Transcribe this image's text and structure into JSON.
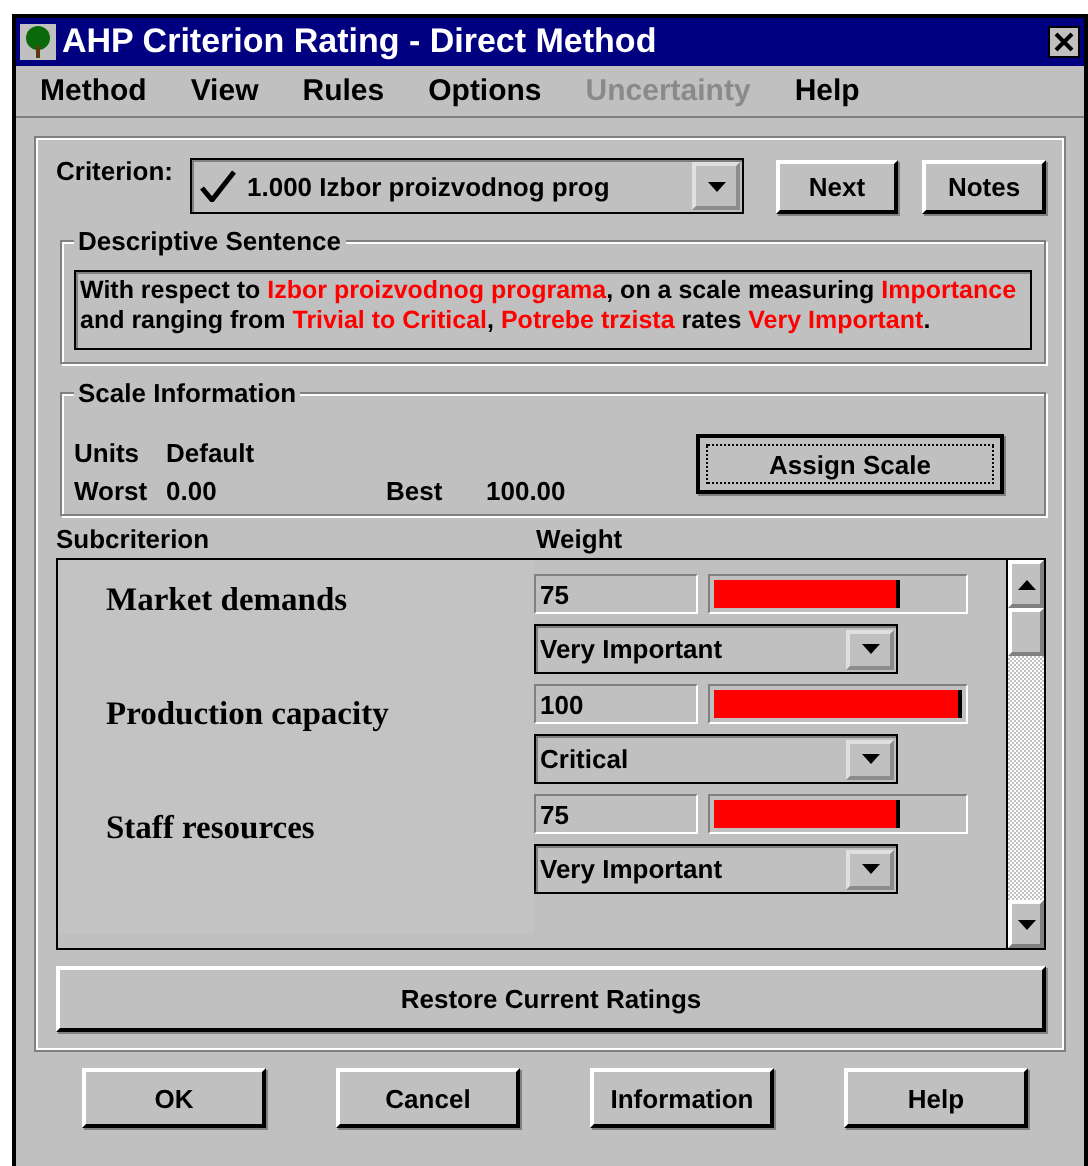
{
  "window": {
    "title": "AHP Criterion Rating - Direct Method"
  },
  "menu": [
    {
      "label": "Method",
      "disabled": false
    },
    {
      "label": "View",
      "disabled": false
    },
    {
      "label": "Rules",
      "disabled": false
    },
    {
      "label": "Options",
      "disabled": false
    },
    {
      "label": "Uncertainty",
      "disabled": true
    },
    {
      "label": "Help",
      "disabled": false
    }
  ],
  "criterion": {
    "label": "Criterion:",
    "checked": true,
    "value": "1.000  Izbor proizvodnog prog",
    "buttons": [
      "Next",
      "Notes"
    ]
  },
  "descriptive_sentence": {
    "title": "Descriptive Sentence",
    "segments": [
      {
        "text": "With respect to ",
        "highlight": false
      },
      {
        "text": "Izbor proizvodnog programa",
        "highlight": true
      },
      {
        "text": ", on a scale measuring ",
        "highlight": false
      },
      {
        "text": "Importance",
        "highlight": true
      },
      {
        "text": " and ranging from ",
        "highlight": false
      },
      {
        "text": "Trivial to Critical",
        "highlight": true
      },
      {
        "text": ", ",
        "highlight": false
      },
      {
        "text": "Potrebe trzista",
        "highlight": true
      },
      {
        "text": " rates ",
        "highlight": false
      },
      {
        "text": "Very Important",
        "highlight": true
      },
      {
        "text": ".",
        "highlight": false
      }
    ]
  },
  "scale_information": {
    "title": "Scale Information",
    "units_label": "Units",
    "units": "Default",
    "worst_label": "Worst",
    "worst": "0.00",
    "best_label": "Best",
    "best": "100.00",
    "button": "Assign Scale"
  },
  "table": {
    "columns": [
      "Subcriterion",
      "Weight"
    ],
    "rows": [
      {
        "name": "Market demands",
        "weight": "75",
        "level": 0.75,
        "rating": "Very Important"
      },
      {
        "name": "Production capacity",
        "weight": "100",
        "level": 1.0,
        "rating": "Critical"
      },
      {
        "name": "Staff resources",
        "weight": "75",
        "level": 0.75,
        "rating": "Very Important"
      }
    ]
  },
  "restore_button": "Restore Current Ratings",
  "buttons": [
    "OK",
    "Cancel",
    "Information",
    "Help"
  ]
}
